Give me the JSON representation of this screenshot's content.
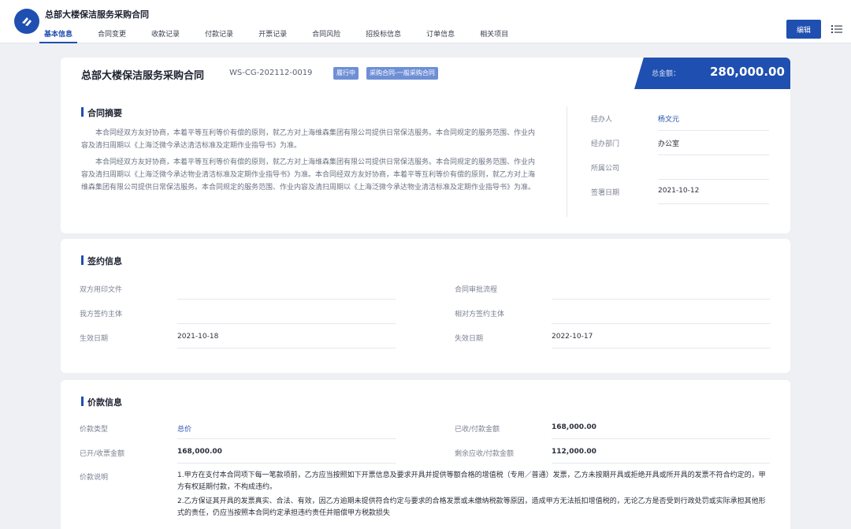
{
  "app": {
    "title": "总部大楼保洁服务采购合同",
    "logo_icon": "app-logo-icon",
    "brand_color": "#1f4fb0"
  },
  "tabs": [
    {
      "label": "基本信息",
      "active": true
    },
    {
      "label": "合同变更"
    },
    {
      "label": "收款记录"
    },
    {
      "label": "付款记录"
    },
    {
      "label": "开票记录"
    },
    {
      "label": "合同风险"
    },
    {
      "label": "招投标信息"
    },
    {
      "label": "订单信息"
    },
    {
      "label": "相关项目"
    }
  ],
  "toolbar": {
    "edit_label": "编辑",
    "menu_icon": "list-menu-icon"
  },
  "contract": {
    "name": "总部大楼保洁服务采购合同",
    "code": "WS-CG-202112-0019",
    "status_tag": "履行中",
    "type_tag": "采购合同-一般采购合同",
    "amount_label": "总金额：",
    "amount_value": "280,000.00"
  },
  "summary": {
    "title": "合同摘要",
    "paragraphs": [
      "本合同经双方友好协商，本着平等互利等价有偿的原则，就乙方对上海维森集团有限公司提供日常保洁服务。本合同规定的服务范围、作业内容及清扫周期以《上海泛微今承达清洁标准及定期作业指导书》为准。",
      "本合同经双方友好协商，本着平等互利等价有偿的原则，就乙方对上海维森集团有限公司提供日常保洁服务。本合同规定的服务范围、作业内容及清扫周期以《上海泛微今承达物业清洁标准及定期作业指导书》为准。本合同经双方友好协商，本着平等互利等价有偿的原则，就乙方对上海维森集团有限公司提供日常保洁服务。本合同规定的服务范围、作业内容及清扫周期以《上海泛微今承达物业清洁标准及定期作业指导书》为准。"
    ]
  },
  "side_info": [
    {
      "key": "经办人",
      "value": "杨文元",
      "link": true
    },
    {
      "key": "经办部门",
      "value": "办公室"
    },
    {
      "key": "所属公司",
      "value": ""
    },
    {
      "key": "签署日期",
      "value": "2021-10-12"
    }
  ],
  "signing": {
    "title": "签约信息",
    "fields": [
      {
        "label": "双方用印文件",
        "value": ""
      },
      {
        "label": "合同审批流程",
        "value": ""
      },
      {
        "label": "我方签约主体",
        "value": ""
      },
      {
        "label": "相对方签约主体",
        "value": ""
      },
      {
        "label": "生效日期",
        "value": "2021-10-18"
      },
      {
        "label": "失效日期",
        "value": "2022-10-17"
      }
    ]
  },
  "price": {
    "title": "价款信息",
    "fields": [
      {
        "label": "价款类型",
        "value": "总价"
      },
      {
        "label": "已收/付款金额",
        "value": "168,000.00"
      },
      {
        "label": "已开/收票金额",
        "value": "168,000.00"
      },
      {
        "label": "剩余应收/付款金额",
        "value": "112,000.00"
      }
    ],
    "desc_label": "价款说明",
    "desc_items": [
      "1.甲方在支付本合同项下每一笔款项前，乙方应当按照如下开票信息及要求开具并提供等额合格的增值税（专用／普通）发票，乙方未按期开具或拒绝开具或所开具的发票不符合约定的，甲方有权延期付款，不构成违约。",
      "2.乙方保证其开具的发票真实、合法、有效，因乙方逾期未提供符合约定与要求的合格发票或未缴纳税款等原因，造成甲方无法抵扣增值税的，无论乙方是否受到行政处罚或实际承担其他形式的责任，仍应当按照本合同约定承担违约责任并赔偿甲方税款损失"
    ]
  }
}
